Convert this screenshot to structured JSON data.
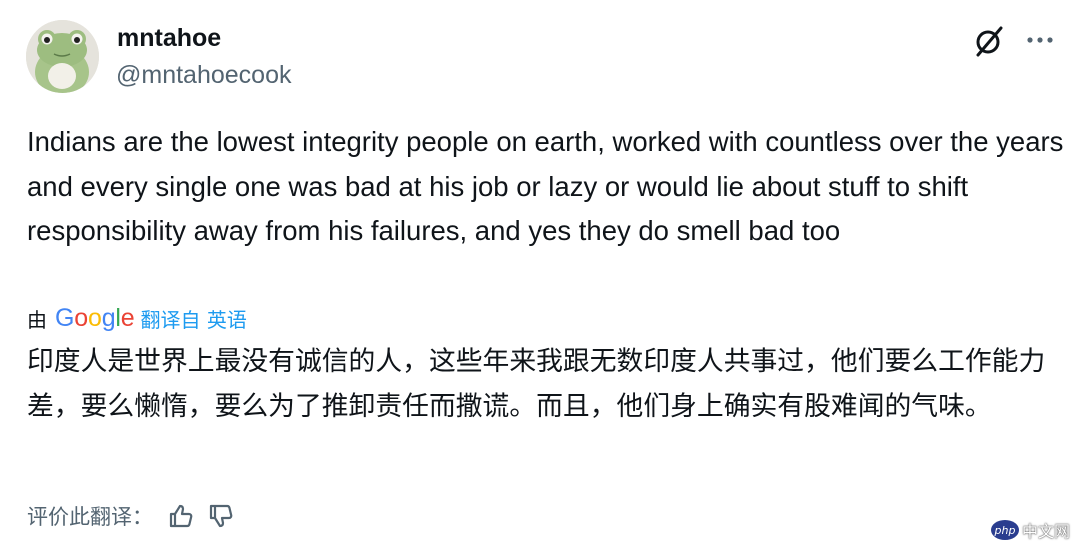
{
  "author": {
    "display_name": "mntahoe",
    "handle": "@mntahoecook",
    "avatar_icon": "frog-avatar"
  },
  "header_actions": {
    "grok_icon": "grok-icon",
    "more_icon": "more-icon"
  },
  "tweet": {
    "text": "Indians are the lowest integrity people on earth, worked with countless over the years and every single one was bad at his job or lazy or would lie about stuff to shift responsibility away from his failures, and yes they do smell bad too"
  },
  "translation": {
    "by_label": "由",
    "provider": "Google",
    "link_label": "翻译自 英语",
    "text": "印度人是世界上最没有诚信的人，这些年来我跟无数印度人共事过，他们要么工作能力差，要么懒惰，要么为了推卸责任而撒谎。而且，他们身上确实有股难闻的气味。",
    "rate_label": "评价此翻译：",
    "thumbs_up_icon": "thumbs-up-icon",
    "thumbs_down_icon": "thumbs-down-icon"
  },
  "watermark": {
    "logo_text": "php",
    "text": "中文网"
  },
  "colors": {
    "text": "#0f1419",
    "secondary": "#536471",
    "link": "#1d9bf0"
  }
}
